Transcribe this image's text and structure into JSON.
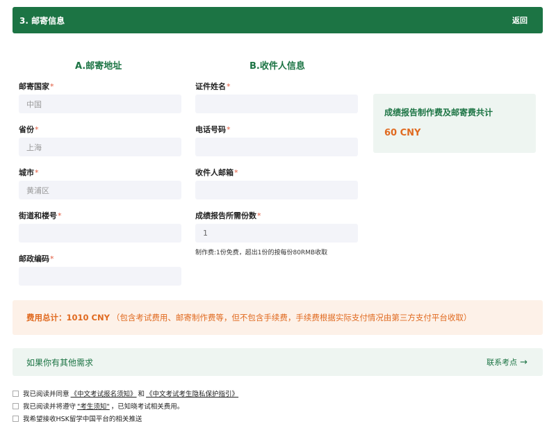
{
  "header": {
    "title": "3. 邮寄信息",
    "back_label": "返回"
  },
  "columns": {
    "a_title": "A.邮寄地址",
    "b_title": "B.收件人信息"
  },
  "address": {
    "country": {
      "label": "邮寄国家",
      "value": "中国"
    },
    "province": {
      "label": "省份",
      "value": "上海"
    },
    "city": {
      "label": "城市",
      "value": "黄浦区"
    },
    "street": {
      "label": "街道和楼号",
      "value": ""
    },
    "postcode": {
      "label": "邮政编码",
      "value": ""
    }
  },
  "recipient": {
    "name": {
      "label": "证件姓名",
      "value": ""
    },
    "phone": {
      "label": "电话号码",
      "value": ""
    },
    "email": {
      "label": "收件人邮箱",
      "value": ""
    },
    "copies": {
      "label": "成绩报告所需份数",
      "value": "1"
    },
    "fee_note": "制作费:1份免费，超出1份的按每份80RMB收取"
  },
  "required_mark": "*",
  "summary": {
    "label": "成绩报告制作费及邮寄费共计",
    "amount": "60 CNY"
  },
  "total": {
    "label": "费用总计：",
    "amount": "1010 CNY",
    "detail": "（包含考试费用、邮寄制作费等，但不包含手续费，手续费根据实际支付情况由第三方支付平台收取）"
  },
  "other": {
    "text": "如果你有其他需求",
    "link": "联系考点",
    "arrow": "→"
  },
  "agreements": [
    {
      "pre": "我已阅读并同意",
      "link1": "《中文考试报名须知》",
      "mid": "和",
      "link2": "《中文考试考生隐私保护指引》"
    },
    {
      "pre": "我已阅读并将遵守",
      "link1": "\"考生须知\"",
      "post": "，已知晓考试相关费用。"
    },
    {
      "pre": "我希望接收HSK留学中国平台的相关推送"
    }
  ]
}
